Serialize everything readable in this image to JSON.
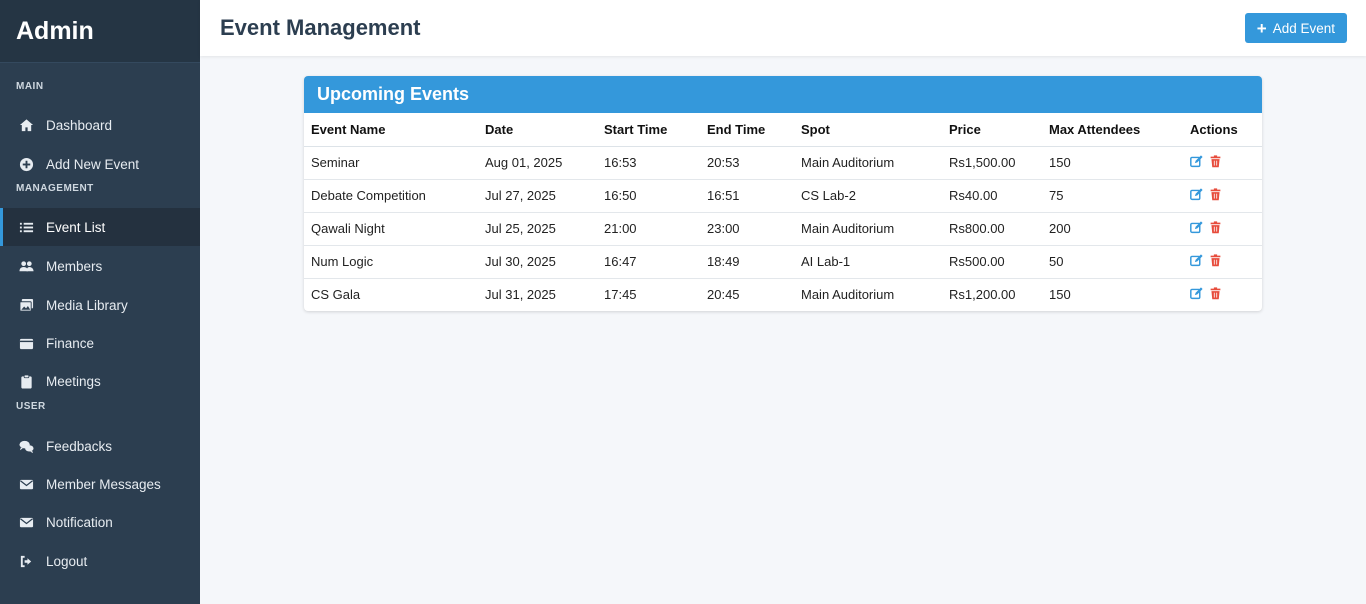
{
  "sidebar": {
    "brand": "Admin",
    "sections": {
      "main": "MAIN",
      "management": "MANAGEMENT",
      "user": "USER"
    },
    "items": [
      {
        "label": "Dashboard",
        "icon": "home-icon"
      },
      {
        "label": "Add New Event",
        "icon": "plus-circle-icon"
      },
      {
        "label": "Event List",
        "icon": "list-icon",
        "active": true
      },
      {
        "label": "Members",
        "icon": "users-icon"
      },
      {
        "label": "Media Library",
        "icon": "images-icon"
      },
      {
        "label": "Finance",
        "icon": "wallet-icon"
      },
      {
        "label": "Meetings",
        "icon": "clipboard-icon"
      },
      {
        "label": "Feedbacks",
        "icon": "comments-icon"
      },
      {
        "label": "Member Messages",
        "icon": "envelope-icon"
      },
      {
        "label": "Notification",
        "icon": "envelope-icon"
      },
      {
        "label": "Logout",
        "icon": "sign-out-icon"
      }
    ]
  },
  "header": {
    "title": "Event Management",
    "add_button": "Add Event"
  },
  "events_card": {
    "title": "Upcoming Events",
    "columns": [
      "Event Name",
      "Date",
      "Start Time",
      "End Time",
      "Spot",
      "Price",
      "Max Attendees",
      "Actions"
    ],
    "rows": [
      [
        "Seminar",
        "Aug 01, 2025",
        "16:53",
        "20:53",
        "Main Auditorium",
        "Rs1,500.00",
        "150"
      ],
      [
        "Debate Competition",
        "Jul 27, 2025",
        "16:50",
        "16:51",
        "CS Lab-2",
        "Rs40.00",
        "75"
      ],
      [
        "Qawali Night",
        "Jul 25, 2025",
        "21:00",
        "23:00",
        "Main Auditorium",
        "Rs800.00",
        "200"
      ],
      [
        "Num Logic",
        "Jul 30, 2025",
        "16:47",
        "18:49",
        "AI Lab-1",
        "Rs500.00",
        "50"
      ],
      [
        "CS Gala",
        "Jul 31, 2025",
        "17:45",
        "20:45",
        "Main Auditorium",
        "Rs1,200.00",
        "150"
      ]
    ]
  },
  "colors": {
    "sidebar_bg": "#2c3e50",
    "accent": "#3498db",
    "edit": "#3498db",
    "delete": "#e74c3c"
  }
}
